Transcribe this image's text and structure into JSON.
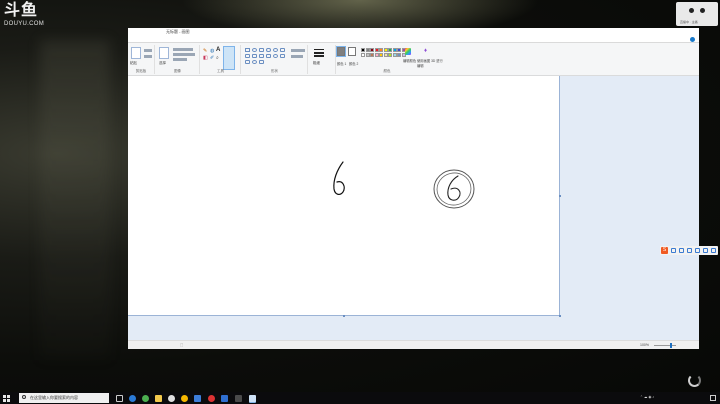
{
  "overlay": {
    "brand_mark": "斗鱼",
    "brand_sub": "DOUYU.COM",
    "camera_caption": "直播中 · 主播"
  },
  "window": {
    "title": "无标题 - 画图",
    "controls": {
      "minimize": "─",
      "maximize": "☐",
      "close": "✕"
    },
    "tabs": [
      "文件",
      "主页",
      "查看"
    ],
    "ribbon_groups": [
      "剪贴板",
      "图像",
      "工具",
      "形状",
      "粗细",
      "颜色"
    ],
    "buttons": {
      "paste": "粘贴",
      "select": "选择",
      "size": "粗细",
      "color1": "颜色 1",
      "color2": "颜色 2",
      "edit_colors": "编辑颜色",
      "paint3d": "使用画图 3D 进行编辑"
    },
    "palette_colors": [
      "#000000",
      "#7f7f7f",
      "#880015",
      "#ed1c24",
      "#ff7f27",
      "#fff200",
      "#22b14c",
      "#00a2e8",
      "#3f48cc",
      "#a349a4",
      "#ffffff",
      "#c3c3c3",
      "#b97a57",
      "#ffaec9",
      "#ffc90e",
      "#efe4b0",
      "#b5e61d",
      "#99d9ea",
      "#7092be",
      "#c8bfe7"
    ],
    "statusbar": {
      "position": "",
      "selection": "",
      "canvas_size": "",
      "zoom": "100%"
    }
  },
  "taskbar": {
    "search_placeholder": "在这里输入你要搜索的内容",
    "clock_time": "",
    "clock_date": ""
  },
  "icons": [
    "start-icon",
    "search-icon",
    "task-view-icon",
    "edge-icon",
    "explorer-icon",
    "store-icon",
    "mail-icon",
    "paint-icon",
    "sogou-icon",
    "spinner-icon"
  ]
}
